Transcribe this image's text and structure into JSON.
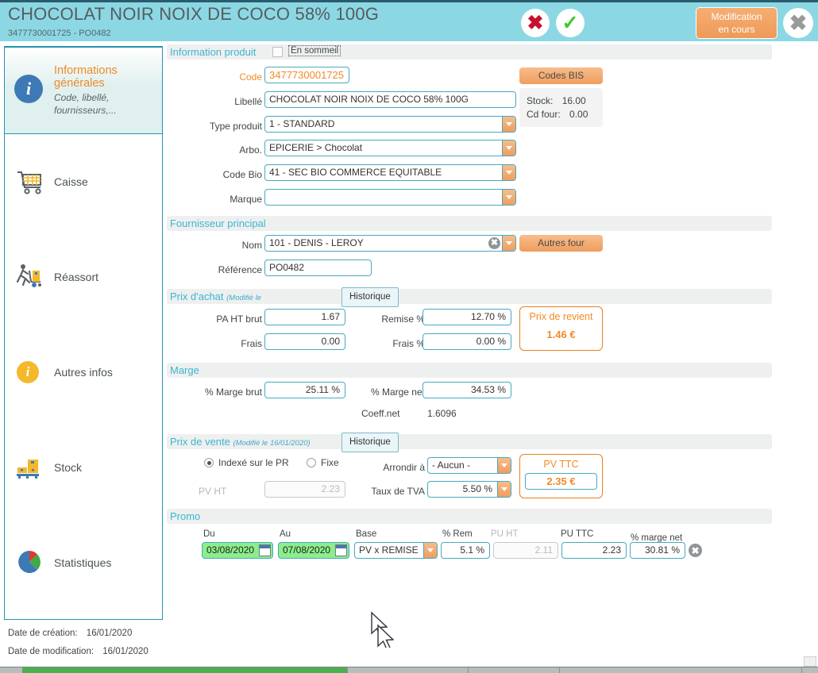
{
  "header": {
    "title": "CHOCOLAT NOIR NOIX DE COCO 58% 100G",
    "subtitle": "3477730001725 - PO0482",
    "reject_icon": "red-x-icon",
    "accept_icon": "green-check-icon",
    "close_icon": "close-x-icon",
    "status_line1": "Modification",
    "status_line2": "en cours"
  },
  "sidebar": {
    "items": [
      {
        "label": "Informations générales",
        "sub1": "Code, libellé,",
        "sub2": "fournisseurs,...",
        "icon": "info-circle-icon",
        "active": true
      },
      {
        "label": "Caisse",
        "icon": "shopping-cart-icon",
        "active": false
      },
      {
        "label": "Réassort",
        "icon": "delivery-handtruck-icon",
        "active": false
      },
      {
        "label": "Autres infos",
        "icon": "info-circle-icon",
        "active": false
      },
      {
        "label": "Stock",
        "icon": "pallet-boxes-icon",
        "active": false
      },
      {
        "label": "Statistiques",
        "icon": "pie-chart-icon",
        "active": false
      }
    ]
  },
  "footer": {
    "creation_label": "Date de création:",
    "creation_value": "16/01/2020",
    "modification_label": "Date de modification:",
    "modification_value": "16/01/2020"
  },
  "product_info": {
    "section_title": "Information produit",
    "sleep_checkbox_label": "En sommeil",
    "sleep_checked": false,
    "code_label": "Code",
    "code_value": "3477730001725",
    "libelle_label": "Libellé",
    "libelle_value": "CHOCOLAT NOIR NOIX DE COCO 58% 100G",
    "type_label": "Type produit",
    "type_value": "1 - STANDARD",
    "arbo_label": "Arbo.",
    "arbo_value": "EPICERIE > Chocolat",
    "codebio_label": "Code Bio",
    "codebio_value": "41 - SEC BIO COMMERCE EQUITABLE",
    "marque_label": "Marque",
    "marque_value": "",
    "codes_bis_button": "Codes BIS",
    "stock_label": "Stock:",
    "stock_value": "16.00",
    "cdfour_label": "Cd four:",
    "cdfour_value": "0.00"
  },
  "supplier": {
    "section_title": "Fournisseur principal",
    "nom_label": "Nom",
    "nom_value": "101 - DENIS - LEROY",
    "reference_label": "Référence",
    "reference_value": "PO0482",
    "autres_four_button": "Autres four"
  },
  "purchase_price": {
    "section_title": "Prix d'achat",
    "section_modif": "(Modifié le",
    "historique_button": "Historique",
    "pa_ht_brut_label": "PA HT brut",
    "pa_ht_brut_value": "1.67",
    "frais_label": "Frais",
    "frais_value": "0.00",
    "remise_label": "Remise %",
    "remise_value": "12.70 %",
    "frais_pct_label": "Frais %",
    "frais_pct_value": "0.00 %",
    "prix_revient_title": "Prix de revient",
    "prix_revient_value": "1.46 €"
  },
  "margin": {
    "section_title": "Marge",
    "marge_brut_label": "% Marge brut",
    "marge_brut_value": "25.11 %",
    "marge_net_label": "% Marge net",
    "marge_net_value": "34.53 %",
    "coeff_label": "Coeff.net",
    "coeff_value": "1.6096"
  },
  "sale_price": {
    "section_title": "Prix de vente",
    "section_modif": "(Modifié le  16/01/2020)",
    "historique_button": "Historique",
    "radio_indexed_label": "Indexé sur le PR",
    "radio_fixe_label": "Fixe",
    "radio_selected": "indexed",
    "pv_ht_label": "PV HT",
    "pv_ht_value": "2.23",
    "arrondir_label": "Arrondir à",
    "arrondir_value": "- Aucun -",
    "tva_label": "Taux de TVA",
    "tva_value": "5.50 %",
    "pv_ttc_title": "PV TTC",
    "pv_ttc_value": "2.35 €"
  },
  "promo": {
    "section_title": "Promo",
    "columns": {
      "du": "Du",
      "au": "Au",
      "base": "Base",
      "rem": "% Rem",
      "pu_ht": "PU HT",
      "pu_ttc": "PU TTC",
      "marge_net": "% marge net"
    },
    "row": {
      "du": "03/08/2020",
      "au": "07/08/2020",
      "base": "PV x REMISE",
      "rem": "5.1 %",
      "pu_ht": "2.11",
      "pu_ttc": "2.23",
      "marge_net": "30.81 %",
      "delete_icon": "delete-circle-icon"
    }
  },
  "colors": {
    "header_bg": "#8bd8e4",
    "accent_orange": "#f08a28",
    "accent_cyan": "#3eb4d2",
    "field_border": "#47a9c0",
    "section_bar_bg": "#eef0ef",
    "promo_date_bg": "#8bee8b",
    "taskbar_green": "#4caf50"
  }
}
